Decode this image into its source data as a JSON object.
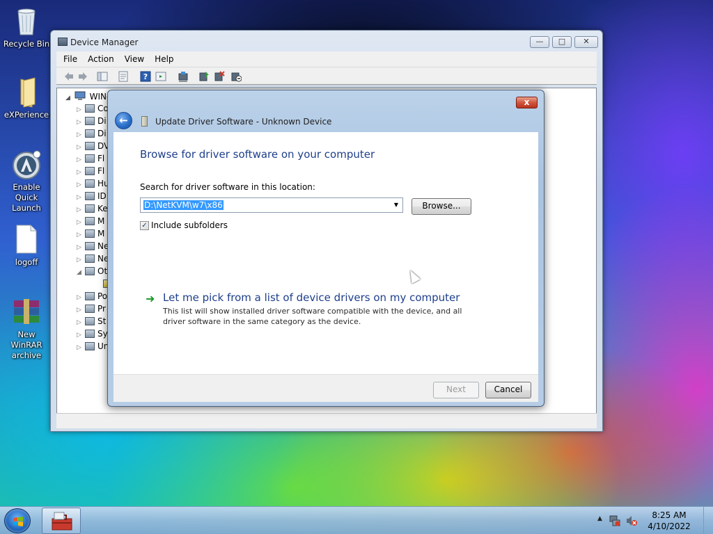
{
  "desktop": {
    "icons": [
      {
        "label": "Recycle Bin",
        "icon": "recycle-bin-icon"
      },
      {
        "label": "eXPerience",
        "icon": "folder-icon"
      },
      {
        "label": "Enable Quick Launch",
        "icon": "quick-launch-icon"
      },
      {
        "label": "logoff",
        "icon": "file-icon"
      },
      {
        "label": "New WinRAR archive",
        "icon": "winrar-icon"
      }
    ]
  },
  "device_manager": {
    "title": "Device Manager",
    "menu": [
      "File",
      "Action",
      "View",
      "Help"
    ],
    "tree": {
      "root_label": "WIN-",
      "items": [
        "Co",
        "Di",
        "Di",
        "DV",
        "Fl",
        "Fl",
        "Hu",
        "ID",
        "Ke",
        "M",
        "M",
        "Ne",
        "Ne",
        "Ot",
        "",
        "Po",
        "Pr",
        "St",
        "Sy",
        "Un"
      ]
    }
  },
  "dialog": {
    "title": "Update Driver Software - Unknown Device",
    "heading": "Browse for driver software on your computer",
    "location_label": "Search for driver software in this location:",
    "path_value": "D:\\NetKVM\\w7\\x86",
    "browse_label": "Browse...",
    "include_subfolders_label": "Include subfolders",
    "include_subfolders_checked": true,
    "pick_title": "Let me pick from a list of device drivers on my computer",
    "pick_description": "This list will show installed driver software compatible with the device, and all driver software in the same category as the device.",
    "next_label": "Next",
    "cancel_label": "Cancel",
    "close_glyph": "x"
  },
  "taskbar": {
    "time": "8:25 AM",
    "date": "4/10/2022"
  }
}
